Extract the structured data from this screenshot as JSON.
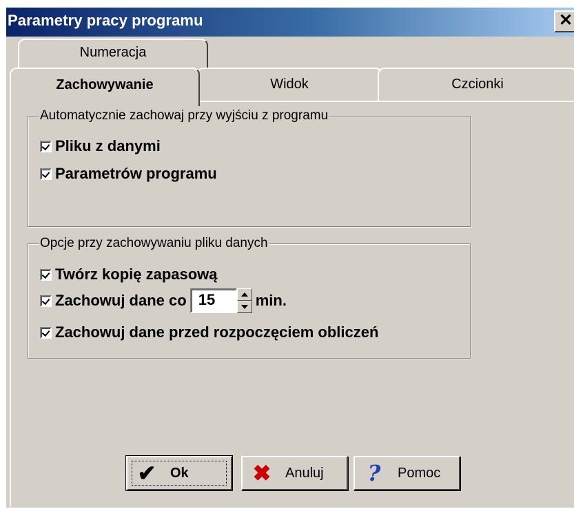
{
  "window": {
    "title": "Parametry pracy programu",
    "close_glyph": "✕"
  },
  "tabs": {
    "back": [
      {
        "label": "Numeracja"
      }
    ],
    "front": [
      {
        "label": "Zachowywanie",
        "active": true
      },
      {
        "label": "Widok"
      },
      {
        "label": "Czcionki"
      }
    ]
  },
  "group_autosave": {
    "legend": "Automatycznie zachowaj przy wyjściu z programu",
    "items": [
      {
        "label": "Pliku z danymi",
        "checked": true
      },
      {
        "label": "Parametrów programu",
        "checked": true
      }
    ]
  },
  "group_save_options": {
    "legend": "Opcje przy zachowywaniu pliku danych",
    "backup": {
      "label": "Twórz kopię zapasową",
      "checked": true
    },
    "interval": {
      "label_before": "Zachowuj dane co",
      "value": "15",
      "label_after": "min.",
      "checked": true
    },
    "before_calc": {
      "label": "Zachowuj dane przed rozpoczęciem obliczeń",
      "checked": true
    }
  },
  "buttons": {
    "ok": {
      "label": "Ok",
      "icon": "check-icon"
    },
    "cancel": {
      "label": "Anuluj",
      "icon": "x-icon"
    },
    "help": {
      "label": "Pomoc",
      "icon": "question-icon"
    }
  },
  "colors": {
    "titlebar_start": "#0a246a",
    "titlebar_end": "#a6caf0",
    "face": "#d4d0c8",
    "cancel_icon": "#cc0000",
    "help_icon": "#1f3fb5"
  }
}
